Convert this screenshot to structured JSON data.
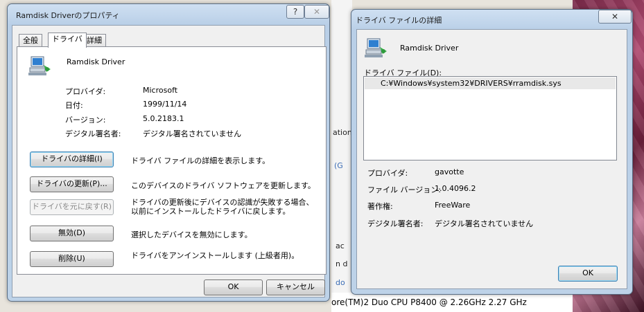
{
  "background": {
    "fragments": [
      "ation",
      "(G",
      "ac",
      "n d",
      "do"
    ],
    "cpu_text": "ore(TM)2 Duo CPU     P8400  @ 2.26GHz   2.27 GHz"
  },
  "props_window": {
    "title": "Ramdisk Driverのプロパティ",
    "help_button": "?",
    "close_button": "✕",
    "tabs": [
      "全般",
      "ドライバ",
      "詳細"
    ],
    "device_name": "Ramdisk Driver",
    "fields": [
      {
        "label": "プロバイダ:",
        "value": "Microsoft"
      },
      {
        "label": "日付:",
        "value": "1999/11/14"
      },
      {
        "label": "バージョン:",
        "value": "5.0.2183.1"
      },
      {
        "label": "デジタル署名者:",
        "value": "デジタル署名されていません"
      }
    ],
    "actions": [
      {
        "button": "ドライバの詳細(I)",
        "desc": "ドライバ ファイルの詳細を表示します。"
      },
      {
        "button": "ドライバの更新(P)...",
        "desc": "このデバイスのドライバ ソフトウェアを更新します。"
      },
      {
        "button": "ドライバを元に戻す(R)",
        "desc": "ドライバの更新後にデバイスの認識が失敗する場合、以前にインストールしたドライバに戻します。"
      },
      {
        "button": "無効(D)",
        "desc": "選択したデバイスを無効にします。"
      },
      {
        "button": "削除(U)",
        "desc": "ドライバをアンインストールします (上級者用)。"
      }
    ],
    "ok": "OK",
    "cancel": "キャンセル"
  },
  "details_window": {
    "title": "ドライバ ファイルの詳細",
    "close_button": "✕",
    "device_name": "Ramdisk Driver",
    "files_label": "ドライバ ファイル(D):",
    "files": [
      "C:¥Windows¥system32¥DRIVERS¥rramdisk.sys"
    ],
    "fields": [
      {
        "label": "プロバイダ:",
        "value": "gavotte"
      },
      {
        "label": "ファイル バージョン:",
        "value": "1.0.4096.2"
      },
      {
        "label": "著作権:",
        "value": "FreeWare"
      },
      {
        "label": "デジタル署名者:",
        "value": "デジタル署名されていません"
      }
    ],
    "ok": "OK"
  },
  "icons": [
    "network-device-icon",
    "help-icon",
    "close-icon"
  ]
}
